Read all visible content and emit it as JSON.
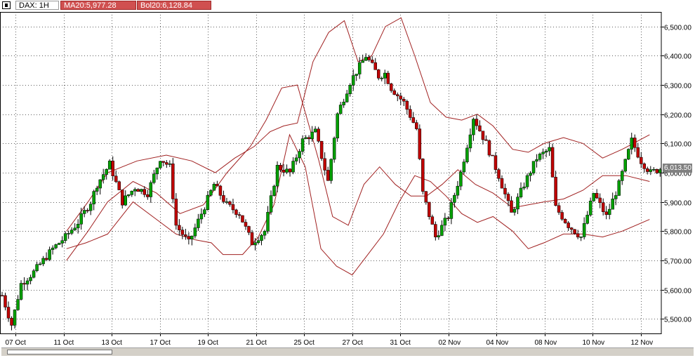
{
  "header": {
    "symbol": "DAX: 1H",
    "ma_label": "MA20:5,977.28",
    "bol_label": "Bol20:6,128.84"
  },
  "colors": {
    "up_candle": "#00a000",
    "down_candle": "#c00000",
    "band_line": "#a02020",
    "grid": "#606060",
    "tab_red": "#d05050"
  },
  "current_price_label": "6,013.50",
  "chart_data": {
    "type": "candlestick",
    "title": "",
    "ylim": [
      5450,
      6550
    ],
    "y_ticks": [
      5500,
      5600,
      5700,
      5800,
      5900,
      6000,
      6100,
      6200,
      6300,
      6400,
      6500
    ],
    "y_tick_labels": [
      "5,500.00",
      "5,600.00",
      "5,700.00",
      "5,800.00",
      "5,900.00",
      "6,000.00",
      "6,100.00",
      "6,200.00",
      "6,300.00",
      "6,400.00",
      "6,500.00"
    ],
    "x_tick_labels": [
      "07 Oct",
      "11 Oct",
      "13 Oct",
      "17 Oct",
      "19 Oct",
      "21 Oct",
      "25 Oct",
      "27 Oct",
      "31 Oct",
      "02 Nov",
      "04 Nov",
      "08 Nov",
      "10 Nov",
      "12 Nov"
    ],
    "current_price": 6013.5,
    "indicators": {
      "ma20_last": 5977.28,
      "bol20_upper_last": 6128.84
    },
    "price_path": [
      [
        0,
        5580
      ],
      [
        3,
        5480
      ],
      [
        6,
        5620
      ],
      [
        10,
        5660
      ],
      [
        16,
        5740
      ],
      [
        20,
        5780
      ],
      [
        24,
        5830
      ],
      [
        28,
        5900
      ],
      [
        30,
        5960
      ],
      [
        34,
        6030
      ],
      [
        38,
        5900
      ],
      [
        42,
        5950
      ],
      [
        46,
        5930
      ],
      [
        50,
        6050
      ],
      [
        53,
        6020
      ],
      [
        55,
        5820
      ],
      [
        59,
        5760
      ],
      [
        63,
        5860
      ],
      [
        67,
        5960
      ],
      [
        71,
        5890
      ],
      [
        75,
        5860
      ],
      [
        79,
        5760
      ],
      [
        83,
        5800
      ],
      [
        87,
        6020
      ],
      [
        91,
        6000
      ],
      [
        95,
        6110
      ],
      [
        99,
        6140
      ],
      [
        103,
        5970
      ],
      [
        106,
        6200
      ],
      [
        110,
        6310
      ],
      [
        115,
        6400
      ],
      [
        119,
        6330
      ],
      [
        121,
        6340
      ],
      [
        123,
        6290
      ],
      [
        127,
        6240
      ],
      [
        131,
        6150
      ],
      [
        133,
        5930
      ],
      [
        137,
        5780
      ],
      [
        141,
        5850
      ],
      [
        145,
        6000
      ],
      [
        149,
        6190
      ],
      [
        153,
        6100
      ],
      [
        157,
        5990
      ],
      [
        161,
        5860
      ],
      [
        165,
        5960
      ],
      [
        169,
        6050
      ],
      [
        173,
        6080
      ],
      [
        175,
        5880
      ],
      [
        179,
        5820
      ],
      [
        183,
        5780
      ],
      [
        187,
        5930
      ],
      [
        191,
        5850
      ],
      [
        195,
        5960
      ],
      [
        199,
        6110
      ],
      [
        202,
        6040
      ],
      [
        205,
        6000
      ],
      [
        208,
        6013.5
      ]
    ],
    "ma20": [
      [
        34,
        5700
      ],
      [
        45,
        5800
      ],
      [
        55,
        5900
      ],
      [
        68,
        5970
      ],
      [
        80,
        5930
      ],
      [
        92,
        5860
      ],
      [
        104,
        5890
      ],
      [
        116,
        6000
      ],
      [
        128,
        6090
      ],
      [
        136,
        6180
      ],
      [
        144,
        6290
      ],
      [
        152,
        6300
      ],
      [
        158,
        6160
      ],
      [
        163,
        6040
      ],
      [
        170,
        5850
      ],
      [
        178,
        5820
      ],
      [
        186,
        5960
      ],
      [
        194,
        6020
      ],
      [
        202,
        5960
      ],
      [
        210,
        5920
      ],
      [
        218,
        5920
      ],
      [
        226,
        5960
      ],
      [
        234,
        6010
      ],
      [
        243,
        5960
      ],
      [
        252,
        5930
      ],
      [
        262,
        5880
      ],
      [
        270,
        5890
      ],
      [
        278,
        5900
      ],
      [
        288,
        5910
      ],
      [
        298,
        5940
      ],
      [
        308,
        5990
      ],
      [
        320,
        5990
      ],
      [
        332,
        5970
      ]
    ],
    "bol_upper": [
      [
        34,
        5800
      ],
      [
        45,
        5900
      ],
      [
        55,
        6000
      ],
      [
        70,
        6040
      ],
      [
        85,
        6060
      ],
      [
        98,
        6040
      ],
      [
        110,
        6000
      ],
      [
        120,
        6050
      ],
      [
        130,
        6090
      ],
      [
        138,
        6140
      ],
      [
        145,
        6160
      ],
      [
        152,
        6170
      ],
      [
        160,
        6380
      ],
      [
        168,
        6480
      ],
      [
        176,
        6520
      ],
      [
        183,
        6380
      ],
      [
        190,
        6400
      ],
      [
        197,
        6500
      ],
      [
        205,
        6530
      ],
      [
        212,
        6400
      ],
      [
        220,
        6240
      ],
      [
        228,
        6190
      ],
      [
        236,
        6180
      ],
      [
        244,
        6200
      ],
      [
        252,
        6160
      ],
      [
        262,
        6080
      ],
      [
        270,
        6070
      ],
      [
        278,
        6100
      ],
      [
        288,
        6120
      ],
      [
        298,
        6100
      ],
      [
        308,
        6050
      ],
      [
        318,
        6080
      ],
      [
        332,
        6130
      ]
    ],
    "bol_lower": [
      [
        34,
        5740
      ],
      [
        44,
        5760
      ],
      [
        55,
        5790
      ],
      [
        68,
        5900
      ],
      [
        80,
        5840
      ],
      [
        90,
        5790
      ],
      [
        100,
        5770
      ],
      [
        108,
        5760
      ],
      [
        114,
        5720
      ],
      [
        124,
        5720
      ],
      [
        132,
        5780
      ],
      [
        140,
        5890
      ],
      [
        148,
        6130
      ],
      [
        156,
        6020
      ],
      [
        164,
        5740
      ],
      [
        172,
        5680
      ],
      [
        180,
        5650
      ],
      [
        188,
        5720
      ],
      [
        196,
        5790
      ],
      [
        204,
        5900
      ],
      [
        212,
        5990
      ],
      [
        220,
        5970
      ],
      [
        228,
        5920
      ],
      [
        236,
        5860
      ],
      [
        244,
        5830
      ],
      [
        252,
        5850
      ],
      [
        262,
        5800
      ],
      [
        270,
        5740
      ],
      [
        278,
        5760
      ],
      [
        288,
        5790
      ],
      [
        298,
        5790
      ],
      [
        308,
        5780
      ],
      [
        318,
        5800
      ],
      [
        332,
        5840
      ]
    ]
  }
}
